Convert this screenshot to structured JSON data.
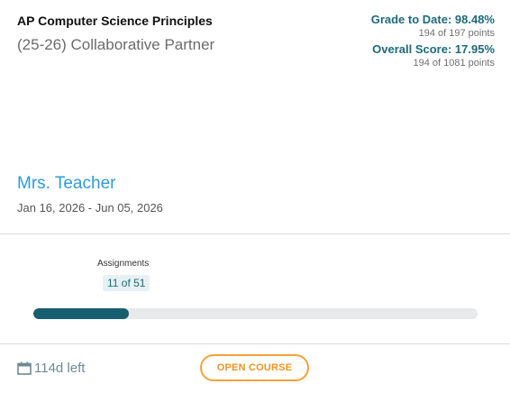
{
  "course": {
    "title": "AP Computer Science Principles",
    "section": "(25-26) Collaborative Partner",
    "teacher": "Mrs. Teacher",
    "dates": "Jan 16, 2026 - Jun 05, 2026"
  },
  "grades": {
    "grade_to_date": "Grade to Date: 98.48%",
    "grade_points": "194 of 197 points",
    "overall_score": "Overall Score: 17.95%",
    "overall_points": "194 of 1081 points"
  },
  "assignments": {
    "label": "Assignments",
    "count": "11 of 51",
    "completed": 11,
    "total": 51
  },
  "footer": {
    "days_left": "114d left",
    "calendar_icon": "calendar-icon",
    "open_course_label": "OPEN COURSE"
  },
  "colors": {
    "accent_teal": "#175f6e",
    "teacher_blue": "#2f9bd9",
    "button_orange": "#f3a23b"
  }
}
